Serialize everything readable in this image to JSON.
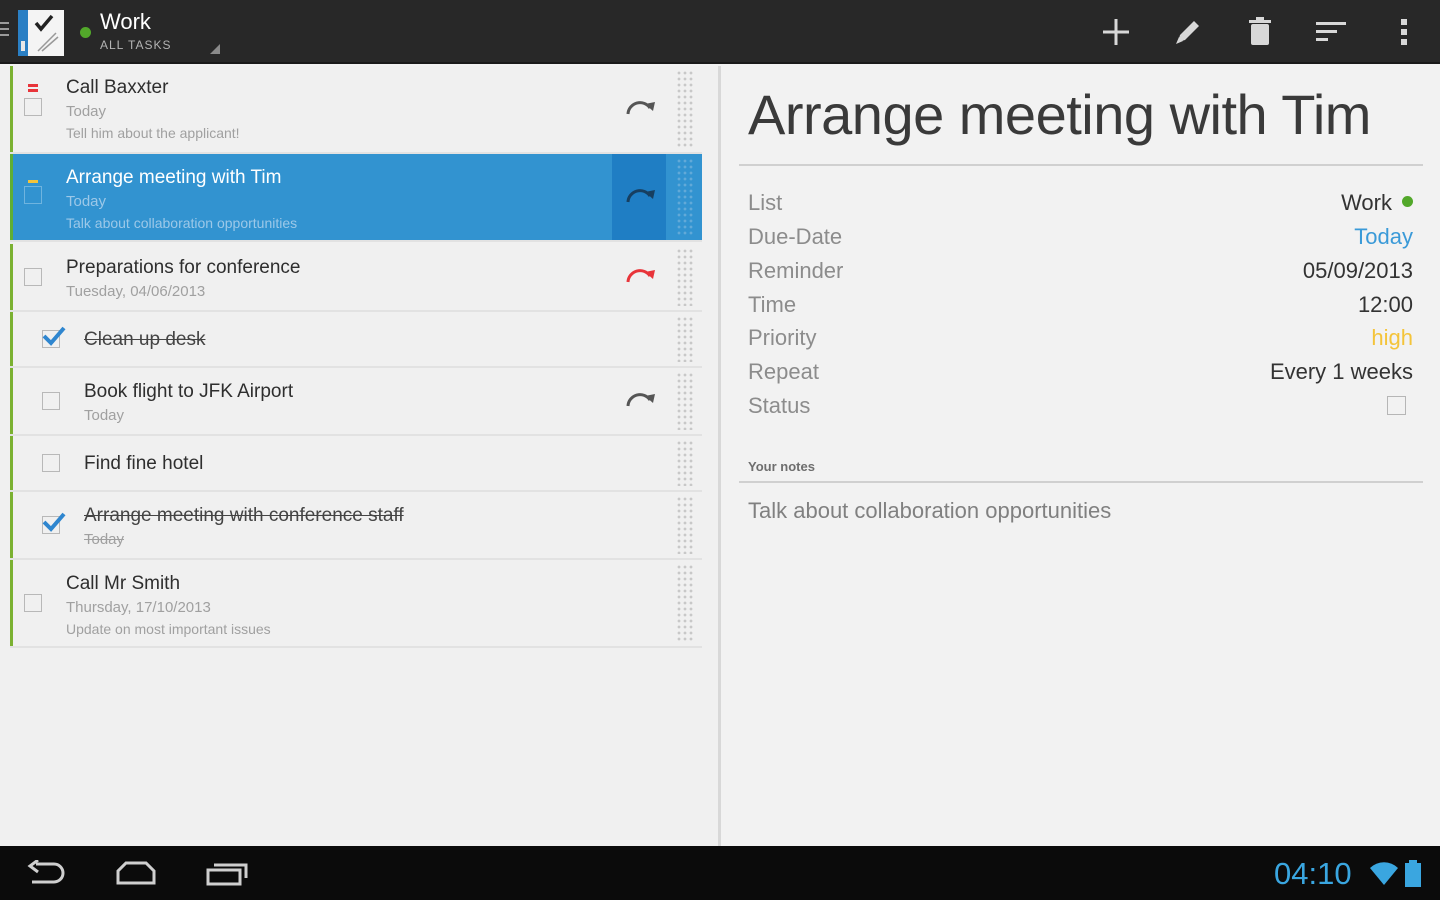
{
  "colors": {
    "accent": "#3293d0",
    "list_green": "#52a82a",
    "priority_high": "#f4c43a",
    "due_today": "#3a9ad8",
    "repeat_red": "#e8343a",
    "clock": "#3aa6e0"
  },
  "actionbar": {
    "title": "Work",
    "subtitle": "ALL TASKS",
    "actions": [
      {
        "id": "add",
        "icon": "plus-icon"
      },
      {
        "id": "edit",
        "icon": "pencil-icon"
      },
      {
        "id": "delete",
        "icon": "trash-icon"
      },
      {
        "id": "sort",
        "icon": "sort-icon"
      },
      {
        "id": "overflow",
        "icon": "overflow-menu-icon"
      }
    ]
  },
  "tasks": [
    {
      "title": "Call Baxxter",
      "date": "Today",
      "note": "Tell him about the applicant!",
      "done": false,
      "selected": false,
      "repeat": "grey",
      "priority": "red"
    },
    {
      "title": "Arrange meeting with Tim",
      "date": "Today",
      "note": "Talk about collaboration opportunities",
      "done": false,
      "selected": true,
      "repeat": "grey",
      "priority": "yellow"
    },
    {
      "title": "Preparations for conference",
      "date": "Tuesday, 04/06/2013",
      "note": "",
      "done": false,
      "selected": false,
      "repeat": "red",
      "priority": ""
    },
    {
      "title": "Clean up desk",
      "date": "",
      "note": "",
      "done": true,
      "selected": false,
      "repeat": "",
      "priority": ""
    },
    {
      "title": "Book flight to JFK Airport",
      "date": "Today",
      "note": "",
      "done": false,
      "selected": false,
      "repeat": "grey",
      "priority": ""
    },
    {
      "title": "Find fine hotel",
      "date": "",
      "note": "",
      "done": false,
      "selected": false,
      "repeat": "",
      "priority": ""
    },
    {
      "title": "Arrange meeting with conference staff",
      "date": "Today",
      "note": "",
      "done": true,
      "selected": false,
      "repeat": "",
      "priority": ""
    },
    {
      "title": "Call Mr Smith",
      "date": "Thursday, 17/10/2013",
      "note": "Update on most important issues",
      "done": false,
      "selected": false,
      "repeat": "",
      "priority": ""
    }
  ],
  "detail": {
    "title": "Arrange meeting with Tim",
    "properties": [
      {
        "label": "List",
        "value": "Work"
      },
      {
        "label": "Due-Date",
        "value": "Today"
      },
      {
        "label": "Reminder",
        "value": "05/09/2013"
      },
      {
        "label": "Time",
        "value": "12:00"
      },
      {
        "label": "Priority",
        "value": "high"
      },
      {
        "label": "Repeat",
        "value": "Every 1 weeks"
      },
      {
        "label": "Status",
        "value": ""
      }
    ],
    "notes_label": "Your notes",
    "notes": "Talk about collaboration opportunities"
  },
  "system": {
    "clock": "04:10",
    "nav": [
      "back-icon",
      "home-icon",
      "recents-icon"
    ],
    "status_icons": [
      "wifi-icon",
      "battery-icon"
    ]
  }
}
